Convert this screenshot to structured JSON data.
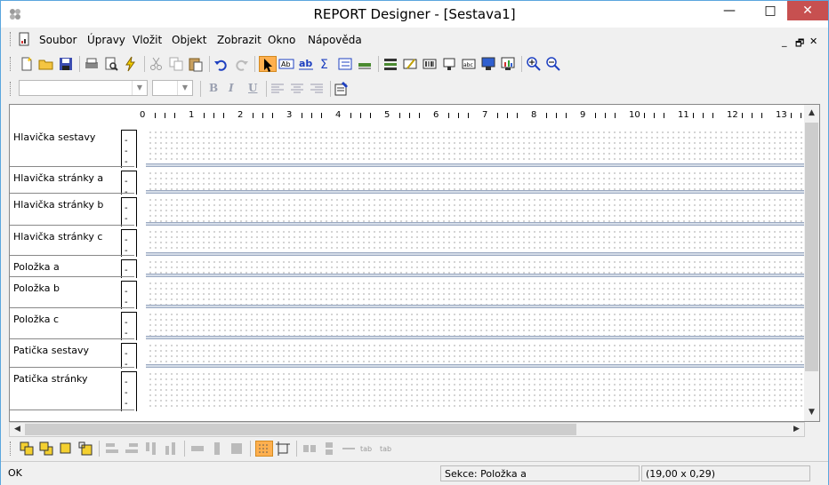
{
  "window": {
    "title": "REPORT Designer - [Sestava1]",
    "minimize_glyph": "—",
    "maximize_glyph": "□",
    "close_glyph": "✕"
  },
  "menubar": {
    "items": [
      {
        "label": "Soubor"
      },
      {
        "label": "Úpravy"
      },
      {
        "label": "Vložit"
      },
      {
        "label": "Objekt"
      },
      {
        "label": "Zobrazit"
      },
      {
        "label": "Okno"
      },
      {
        "label": "Nápověda"
      }
    ],
    "mdi_controls": {
      "minimize": "_",
      "restore": "🗗",
      "close": "✕"
    }
  },
  "format_toolbar": {
    "font_name_value": "",
    "font_size_value": "",
    "bold": "B",
    "italic": "I",
    "underline": "U"
  },
  "ruler": {
    "labels": [
      "0",
      "1",
      "2",
      "3",
      "4",
      "5",
      "6",
      "7",
      "8",
      "9",
      "10",
      "11",
      "12",
      "13"
    ]
  },
  "sections": [
    {
      "label": "Hlavička sestavy"
    },
    {
      "label": "Hlavička stránky a"
    },
    {
      "label": "Hlavička stránky b"
    },
    {
      "label": "Hlavička stránky c"
    },
    {
      "label": "Položka a"
    },
    {
      "label": "Položka b"
    },
    {
      "label": "Položka c"
    },
    {
      "label": "Patička sestavy"
    },
    {
      "label": "Patička stránky"
    }
  ],
  "statusbar": {
    "message": "OK",
    "section": "Sekce: Položka a",
    "dimensions": "(19,00 x 0,29)"
  },
  "colors": {
    "accent": "#5aa6de",
    "close_button": "#c75050",
    "selected_tool": "#ffb04f"
  }
}
